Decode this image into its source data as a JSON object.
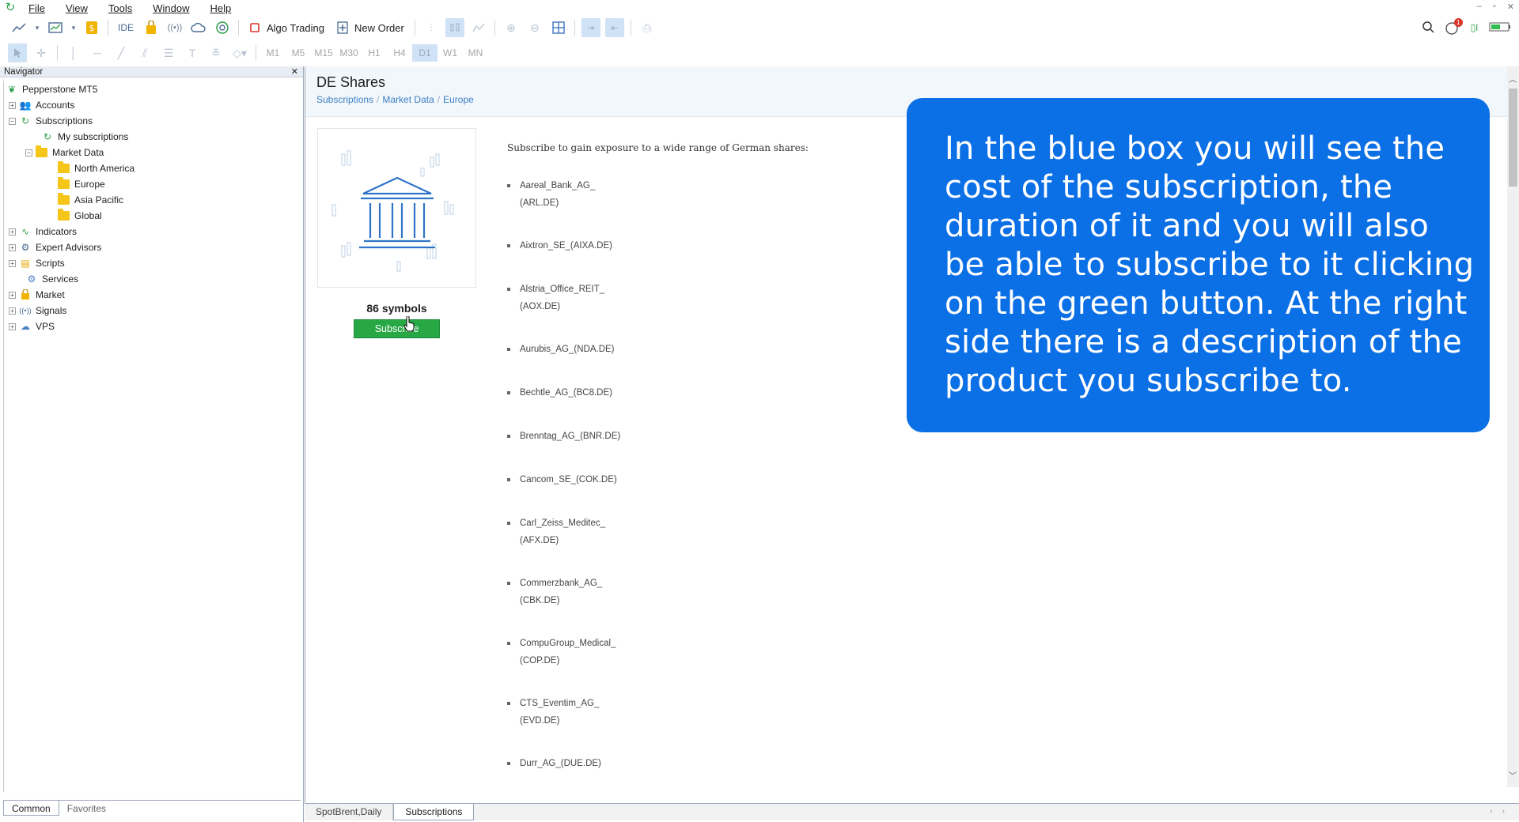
{
  "menu": {
    "items": [
      "File",
      "View",
      "Tools",
      "Window",
      "Help"
    ]
  },
  "toolbar": {
    "ide_label": "IDE",
    "algo_trading_label": "Algo Trading",
    "new_order_label": "New Order",
    "notification_count": "1"
  },
  "timeframes": [
    "M1",
    "M5",
    "M15",
    "M30",
    "H1",
    "H4",
    "D1",
    "W1",
    "MN"
  ],
  "active_timeframe": "D1",
  "navigator": {
    "title": "Navigator",
    "root": "Pepperstone MT5",
    "items": {
      "accounts": "Accounts",
      "subscriptions": "Subscriptions",
      "my_subscriptions": "My subscriptions",
      "market_data": "Market Data",
      "north_america": "North America",
      "europe": "Europe",
      "asia_pacific": "Asia Pacific",
      "global": "Global",
      "indicators": "Indicators",
      "expert_advisors": "Expert Advisors",
      "scripts": "Scripts",
      "services": "Services",
      "market": "Market",
      "signals": "Signals",
      "vps": "VPS"
    },
    "tabs": [
      "Common",
      "Favorites"
    ]
  },
  "page": {
    "title": "DE Shares",
    "breadcrumb": [
      "Subscriptions",
      "Market Data",
      "Europe"
    ],
    "symbols_count": "86 symbols",
    "subscribe_label": "Subscribe",
    "description": "Subscribe to gain exposure to a wide range of German shares:",
    "symbols": [
      [
        "Aareal_Bank_AG_",
        "(ARL.DE)"
      ],
      [
        "Aixtron_SE_(AIXA.DE)"
      ],
      [
        "Alstria_Office_REIT_",
        "(AOX.DE)"
      ],
      [
        "Aurubis_AG_(NDA.DE)"
      ],
      [
        "Bechtle_AG_(BC8.DE)"
      ],
      [
        "Brenntag_AG_(BNR.DE)"
      ],
      [
        "Cancom_SE_(COK.DE)"
      ],
      [
        "Carl_Zeiss_Meditec_",
        "(AFX.DE)"
      ],
      [
        "Commerzbank_AG_",
        "(CBK.DE)"
      ],
      [
        "CompuGroup_Medical_",
        "(COP.DE)"
      ],
      [
        "CTS_Eventim_AG_",
        "(EVD.DE)"
      ],
      [
        "Durr_AG_(DUE.DE)"
      ]
    ]
  },
  "overlay": {
    "text": "In the blue box you will see the cost of the subscription, the duration of it and you will also be able to subscribe to it clicking on the green button. At the right side there is a description of the product you subscribe to."
  },
  "bottom_tabs": [
    "SpotBrent,Daily",
    "Subscriptions"
  ],
  "colors": {
    "overlay_blue": "#0b6fe6",
    "subscribe_green": "#28a745",
    "link_blue": "#3b7fc4"
  }
}
